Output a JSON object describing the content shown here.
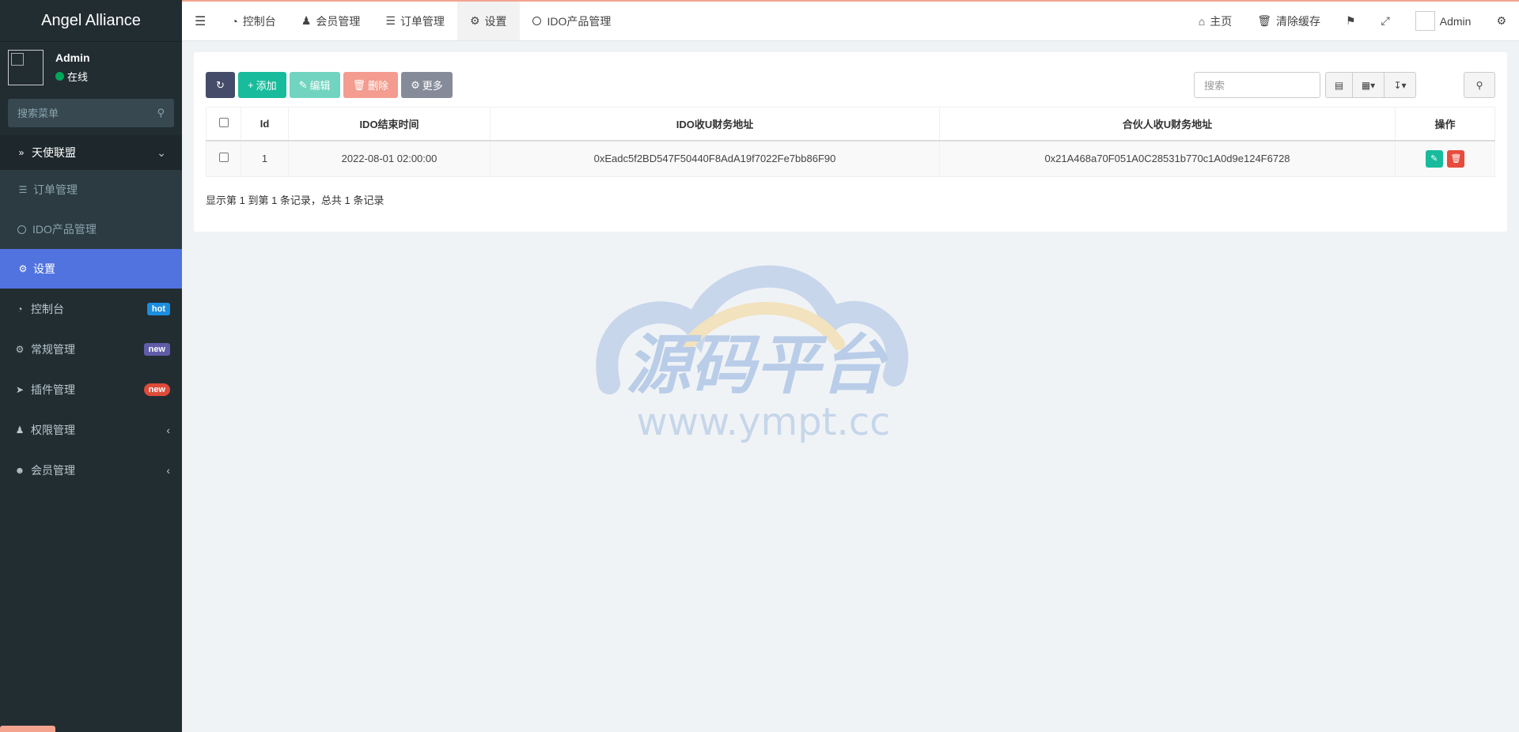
{
  "sidebar": {
    "brand": "Angel Alliance",
    "user_name": "Admin",
    "user_status": "在线",
    "search_placeholder": "搜索菜单",
    "group_label": "天使联盟",
    "sub_items": [
      {
        "label": "订单管理",
        "icon": "list-icon"
      },
      {
        "label": "IDO产品管理",
        "icon": "circle-icon"
      },
      {
        "label": "设置",
        "icon": "gear-icon"
      }
    ],
    "items": [
      {
        "label": "控制台",
        "icon": "dashboard-icon",
        "badge": "hot"
      },
      {
        "label": "常规管理",
        "icon": "cogs-icon",
        "badge": "new"
      },
      {
        "label": "插件管理",
        "icon": "rocket-icon",
        "badge": "new"
      },
      {
        "label": "权限管理",
        "icon": "users-icon",
        "badge": ""
      },
      {
        "label": "会员管理",
        "icon": "user-circle-icon",
        "badge": ""
      }
    ]
  },
  "topnav": {
    "tabs": [
      {
        "label": "控制台",
        "icon": "dashboard-icon"
      },
      {
        "label": "会员管理",
        "icon": "user-icon"
      },
      {
        "label": "订单管理",
        "icon": "list-icon"
      },
      {
        "label": "设置",
        "icon": "gear-icon"
      },
      {
        "label": "IDO产品管理",
        "icon": "circle-icon"
      }
    ],
    "home_label": "主页",
    "clear_cache_label": "清除缓存",
    "admin_label": "Admin"
  },
  "toolbar": {
    "add_label": "添加",
    "edit_label": "编辑",
    "delete_label": "删除",
    "more_label": "更多",
    "search_placeholder": "搜索"
  },
  "table": {
    "headers": [
      "Id",
      "IDO结束时间",
      "IDO收U财务地址",
      "合伙人收U财务地址",
      "操作"
    ],
    "rows": [
      {
        "id": "1",
        "end_time": "2022-08-01 02:00:00",
        "ido_address": "0xEadc5f2BD547F50440F8AdA19f7022Fe7bb86F90",
        "partner_address": "0x21A468a70F051A0C28531b770c1A0d9e124F6728"
      }
    ]
  },
  "summary": "显示第 1 到第 1 条记录，总共 1 条记录",
  "watermark": {
    "title": "源码平台",
    "url": "www.ympt.cc"
  }
}
